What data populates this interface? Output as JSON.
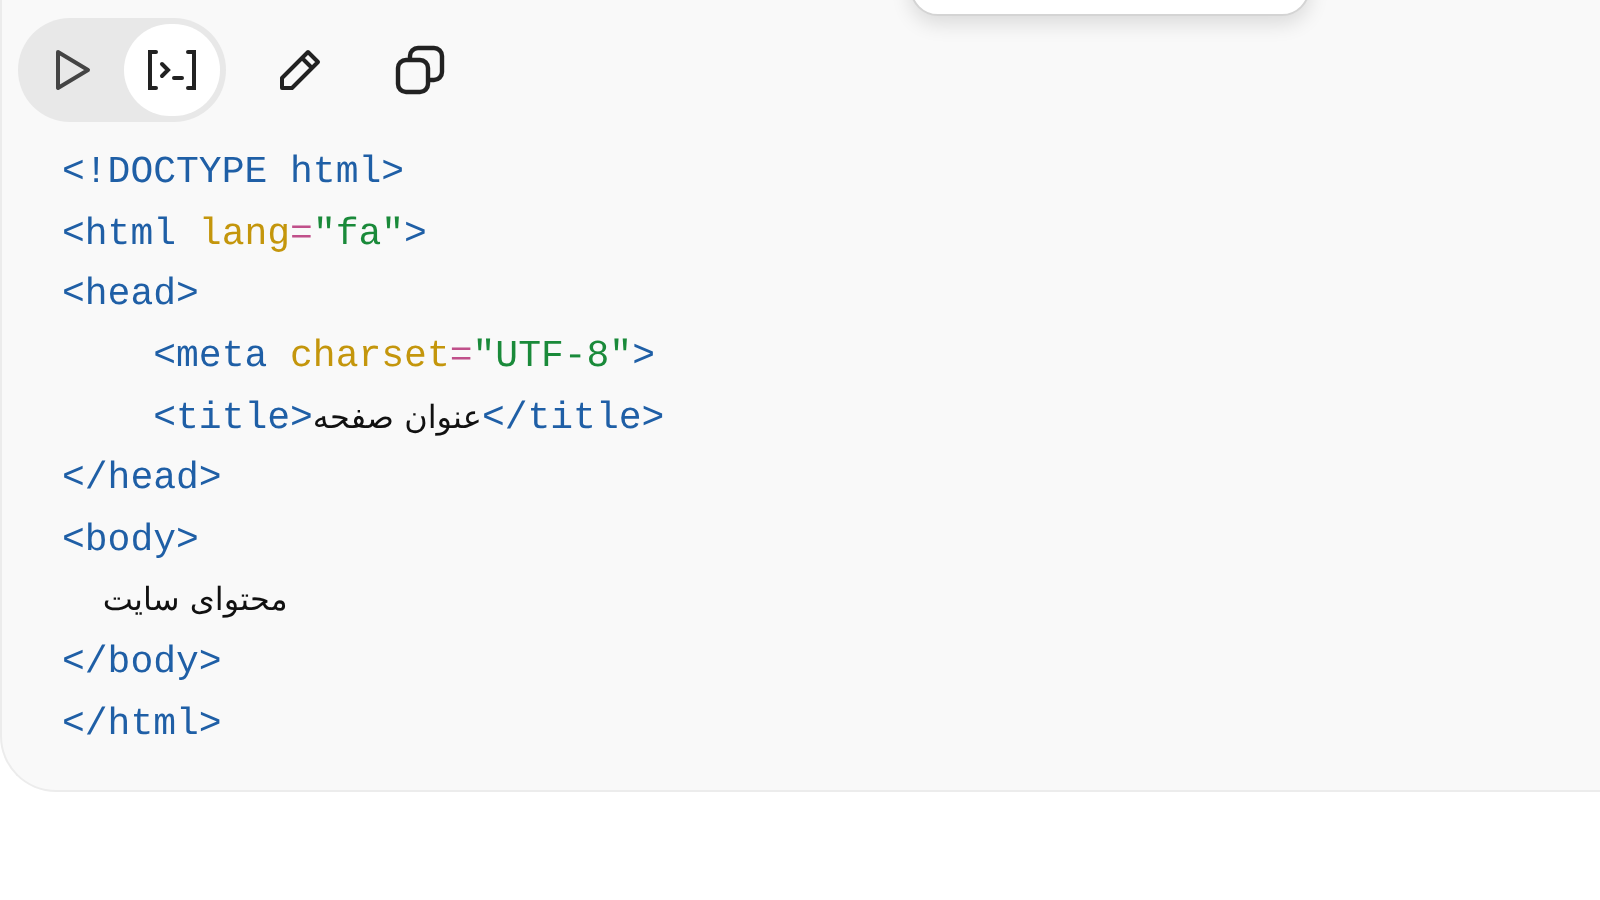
{
  "toolbar": {
    "view_toggle": [
      {
        "kind": "preview",
        "selected": false
      },
      {
        "kind": "code",
        "selected": true
      }
    ],
    "actions": [
      {
        "kind": "edit"
      },
      {
        "kind": "copy"
      }
    ]
  },
  "code_lines": [
    [
      {
        "kind": "tag",
        "text": "<!DOCTYPE html>"
      }
    ],
    [
      {
        "kind": "tag",
        "text": "<html "
      },
      {
        "kind": "attr",
        "text": "lang"
      },
      {
        "kind": "eq",
        "text": "="
      },
      {
        "kind": "str",
        "text": "\"fa\""
      },
      {
        "kind": "tag",
        "text": ">"
      }
    ],
    [
      {
        "kind": "tag",
        "text": "<head>"
      }
    ],
    [
      {
        "kind": "tag",
        "text": "    <meta "
      },
      {
        "kind": "attr",
        "text": "charset"
      },
      {
        "kind": "eq",
        "text": "="
      },
      {
        "kind": "str",
        "text": "\"UTF-8\""
      },
      {
        "kind": "tag",
        "text": ">"
      }
    ],
    [
      {
        "kind": "tag",
        "text": "    <title>"
      },
      {
        "kind": "text",
        "text": "عنوان صفحه"
      },
      {
        "kind": "tag",
        "text": "</title>"
      }
    ],
    [
      {
        "kind": "tag",
        "text": "</head>"
      }
    ],
    [
      {
        "kind": "tag",
        "text": "<body>"
      }
    ],
    [
      {
        "kind": "text",
        "text": "    محتوای سایت"
      }
    ],
    [
      {
        "kind": "tag",
        "text": "</body>"
      }
    ],
    [
      {
        "kind": "tag",
        "text": "</html>"
      }
    ]
  ]
}
